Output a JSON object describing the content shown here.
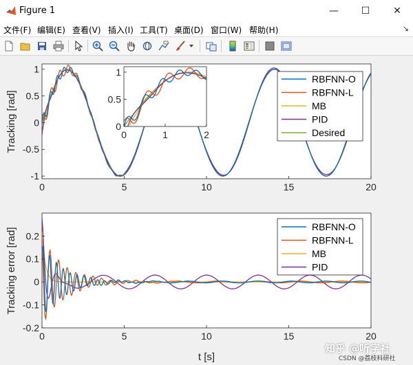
{
  "window": {
    "title": "Figure 1",
    "minimize": "—",
    "maximize": "☐",
    "close": "✕"
  },
  "menu": {
    "items": [
      "文件(F)",
      "编辑(E)",
      "查看(V)",
      "插入(I)",
      "工具(T)",
      "桌面(D)",
      "窗口(W)",
      "帮助(H)"
    ],
    "pin": "↘"
  },
  "toolbar": {
    "icons": [
      "new-figure-icon",
      "open-file-icon",
      "save-icon",
      "print-icon",
      "pointer-icon",
      "zoom-in-icon",
      "zoom-out-icon",
      "pan-hand-icon",
      "rotate-3d-icon",
      "data-cursor-icon",
      "brush-icon",
      "brush-dropdown-icon",
      "link-plot-icon",
      "colorbar-icon",
      "legend-icon",
      "hide-plot-tools-icon",
      "show-plot-tools-icon"
    ]
  },
  "colors": {
    "rbfnn_o": "#0072BD",
    "rbfnn_l": "#D95319",
    "mb": "#EDB120",
    "pid": "#7E2F8E",
    "desired": "#77AC30"
  },
  "watermark": "知乎 @听字社",
  "csdn": "CSDN @荔枝科研社",
  "chart_data": [
    {
      "type": "line",
      "ylabel": "Tracking [rad]",
      "xlabel": "",
      "xlim": [
        0,
        20
      ],
      "ylim": [
        -1.05,
        1.1
      ],
      "xticks": [
        "0",
        "5",
        "10",
        "15",
        "20"
      ],
      "yticks": [
        "-1",
        "-0.5",
        "0",
        "0.5",
        "1"
      ],
      "series": [
        {
          "name": "RBFNN-O"
        },
        {
          "name": "RBFNN-L"
        },
        {
          "name": "MB"
        },
        {
          "name": "PID"
        },
        {
          "name": "Desired"
        }
      ],
      "desired": "sin(x)",
      "legend": "top-right",
      "inset": {
        "xlim": [
          0,
          2
        ],
        "ylim": [
          0,
          1.1
        ],
        "xticks": [
          "0",
          "1",
          "2"
        ],
        "yticks": [
          "0",
          "0.5",
          "1"
        ]
      }
    },
    {
      "type": "line",
      "ylabel": "Tracking error [rad]",
      "xlabel": "t [s]",
      "xlim": [
        0,
        20
      ],
      "ylim": [
        -0.2,
        0.3
      ],
      "xticks": [
        "0",
        "5",
        "10",
        "15",
        "20"
      ],
      "yticks": [
        "-0.2",
        "-0.1",
        "0",
        "0.1",
        "0.2"
      ],
      "series": [
        {
          "name": "RBFNN-O"
        },
        {
          "name": "RBFNN-L"
        },
        {
          "name": "MB"
        },
        {
          "name": "PID"
        }
      ],
      "legend": "top-right"
    }
  ]
}
